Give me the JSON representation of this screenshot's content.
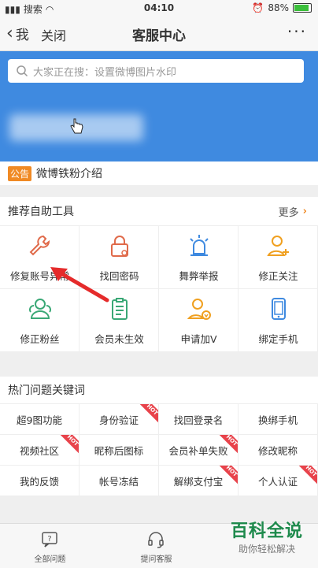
{
  "status": {
    "carrier": "搜索",
    "time": "04:10",
    "battery": "88%",
    "battery_level": 0.88
  },
  "nav": {
    "back": "我",
    "close": "关闭",
    "title": "客服中心",
    "more": "···"
  },
  "search": {
    "placeholder": "大家正在搜：设置微博图片水印"
  },
  "notice": {
    "badge": "公告",
    "text": "微博铁粉介绍"
  },
  "tools": {
    "title": "推荐自助工具",
    "more": "更多",
    "items": [
      {
        "label": "修复账号异常",
        "icon": "wrench-icon"
      },
      {
        "label": "找回密码",
        "icon": "lock-icon"
      },
      {
        "label": "舞弊举报",
        "icon": "siren-icon"
      },
      {
        "label": "修正关注",
        "icon": "user-add-icon"
      },
      {
        "label": "修正粉丝",
        "icon": "users-icon"
      },
      {
        "label": "会员未生效",
        "icon": "clipboard-icon"
      },
      {
        "label": "申请加V",
        "icon": "user-verify-icon"
      },
      {
        "label": "绑定手机",
        "icon": "phone-icon"
      }
    ]
  },
  "keywords": {
    "title": "热门问题关键词",
    "items": [
      {
        "label": "超9图功能",
        "hot": false
      },
      {
        "label": "身份验证",
        "hot": true
      },
      {
        "label": "找回登录名",
        "hot": false
      },
      {
        "label": "换绑手机",
        "hot": false
      },
      {
        "label": "视频社区",
        "hot": true
      },
      {
        "label": "昵称后图标",
        "hot": false
      },
      {
        "label": "会员补单失败",
        "hot": true
      },
      {
        "label": "修改昵称",
        "hot": false
      },
      {
        "label": "我的反馈",
        "hot": false
      },
      {
        "label": "帐号冻结",
        "hot": false
      },
      {
        "label": "解绑支付宝",
        "hot": true
      },
      {
        "label": "个人认证",
        "hot": true
      }
    ],
    "hot_label": "HOT"
  },
  "tabbar": {
    "items": [
      {
        "label": "全部问题",
        "icon": "question-icon"
      },
      {
        "label": "提问客服",
        "icon": "headset-icon"
      }
    ]
  },
  "watermark": {
    "title": "百科全说",
    "subtitle": "助你轻松解决"
  },
  "colors": {
    "accent": "#f08a24",
    "banner": "#3f8ae0",
    "hot": "#e8434b",
    "brand_green": "#1e8a4c"
  }
}
